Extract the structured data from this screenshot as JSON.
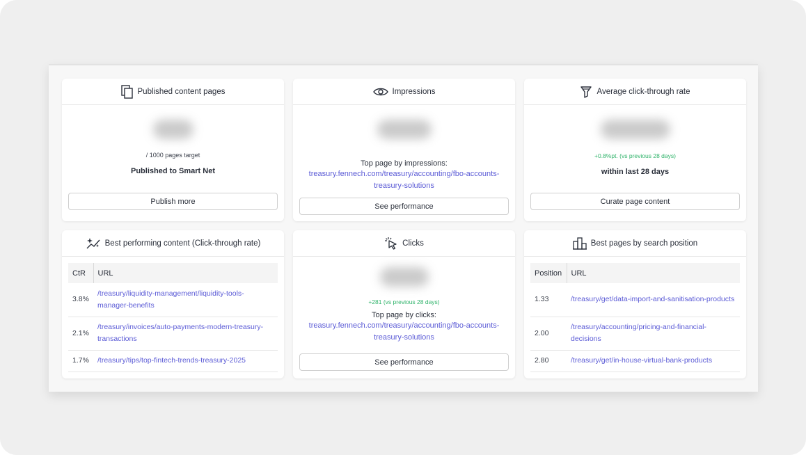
{
  "cards": {
    "published": {
      "title": "Published content pages",
      "target": "/ 1000 pages target",
      "subtitle": "Published to Smart Net",
      "button": "Publish more"
    },
    "impressions": {
      "title": "Impressions",
      "top_label": "Top page by impressions:",
      "top_url": "treasury.fennech.com/treasury/accounting/fbo-accounts-treasury-solutions",
      "button": "See performance"
    },
    "ctr": {
      "title": "Average click-through rate",
      "change": "+0.8%pt. (vs previous 28 days)",
      "subtitle": "within last 28 days",
      "button": "Curate page content"
    },
    "best_content": {
      "title": "Best performing content (Click-through rate)",
      "columns": [
        "CtR",
        "URL"
      ],
      "rows": [
        {
          "value": "3.8%",
          "url": "/treasury/liquidity-management/liquidity-tools-manager-benefits"
        },
        {
          "value": "2.1%",
          "url": "/treasury/invoices/auto-payments-modern-treasury-transactions"
        },
        {
          "value": "1.7%",
          "url": "/treasury/tips/top-fintech-trends-treasury-2025"
        }
      ]
    },
    "clicks": {
      "title": "Clicks",
      "change": "+281 (vs previous 28 days)",
      "top_label": "Top page by clicks:",
      "top_url": "treasury.fennech.com/treasury/accounting/fbo-accounts-treasury-solutions",
      "button": "See performance"
    },
    "best_position": {
      "title": "Best pages by search position",
      "columns": [
        "Position",
        "URL"
      ],
      "rows": [
        {
          "value": "1.33",
          "url": "/treasury/get/data-import-and-sanitisation-products"
        },
        {
          "value": "2.00",
          "url": "/treasury/accounting/pricing-and-financial-decisions"
        },
        {
          "value": "2.80",
          "url": "/treasury/get/in-house-virtual-bank-products"
        }
      ]
    }
  },
  "colors": {
    "link": "#5b5bd6",
    "positive": "#2fb36a"
  },
  "icons": [
    "copy-pages-icon",
    "eye-icon",
    "funnel-icon",
    "sparkle-chart-icon",
    "cursor-click-icon",
    "buildings-icon"
  ]
}
